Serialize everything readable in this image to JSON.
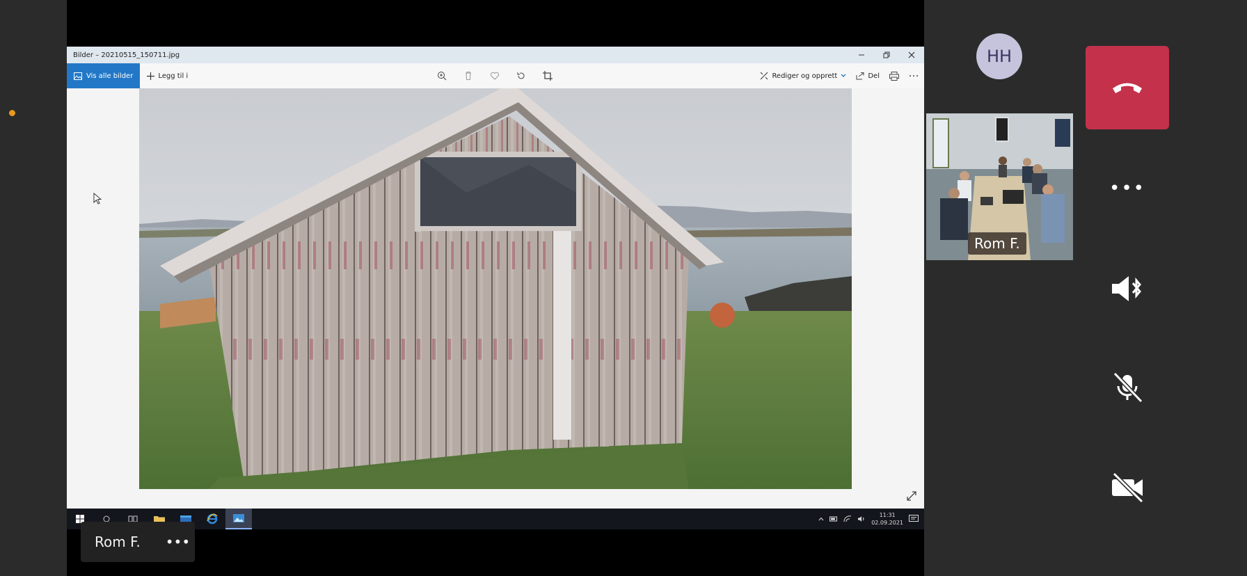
{
  "window": {
    "title": "Bilder – 20210515_150711.jpg"
  },
  "toolbar": {
    "view_all_label": "Vis alle bilder",
    "add_label": "Legg til i",
    "edit_label": "Rediger og opprett",
    "share_label": "Del"
  },
  "taskbar": {
    "time": "11:31",
    "date": "02.09.2021"
  },
  "share_label": {
    "name": "Rom F.",
    "more": "•••"
  },
  "participant": {
    "initials": "HH",
    "room_name": "Rom F."
  },
  "controls": {
    "more": "•••"
  },
  "colors": {
    "accent_blue": "#2278c7",
    "hangup_red": "#c4314b",
    "avatar_bg": "#c6c3dc",
    "status_dot": "#e79a1e"
  }
}
